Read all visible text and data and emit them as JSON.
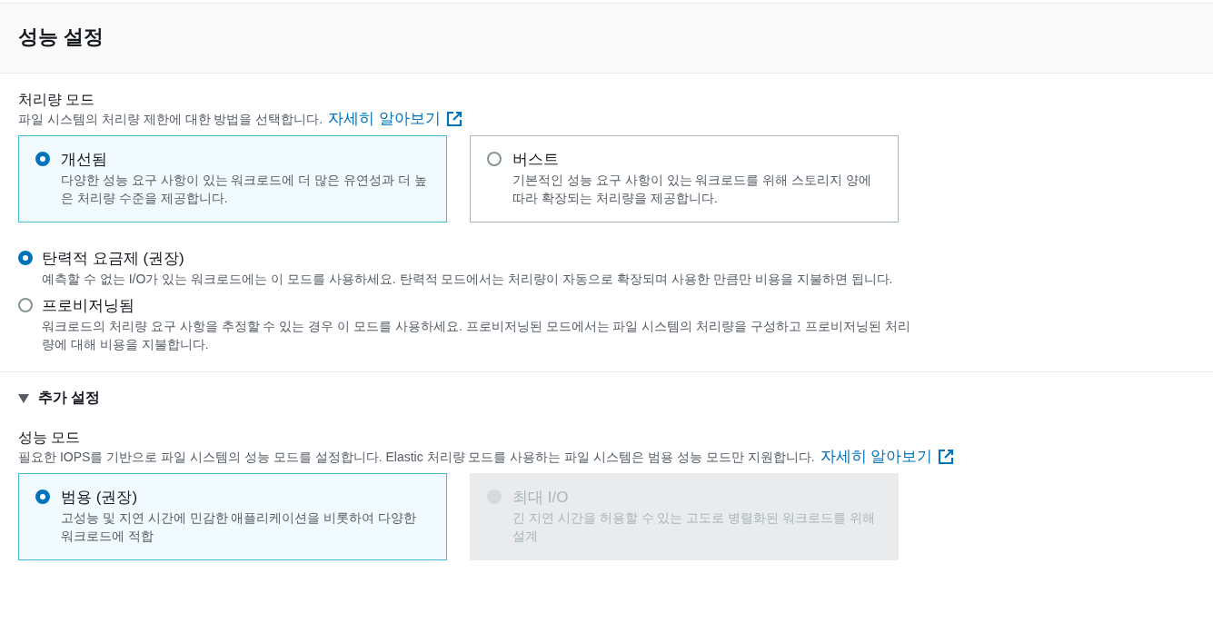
{
  "header": {
    "title": "성능 설정"
  },
  "throughput": {
    "label": "처리량 모드",
    "description": "파일 시스템의 처리량 제한에 대한 방법을 선택합니다.",
    "link": "자세히 알아보기",
    "tiles": [
      {
        "label": "개선됨",
        "description": "다양한 성능 요구 사항이 있는 워크로드에 더 많은 유연성과 더 높은 처리량 수준을 제공합니다.",
        "selected": true,
        "disabled": false
      },
      {
        "label": "버스트",
        "description": "기본적인 성능 요구 사항이 있는 워크로드를 위해 스토리지 양에 따라 확장되는 처리량을 제공합니다.",
        "selected": false,
        "disabled": false
      }
    ]
  },
  "billing_options": [
    {
      "label": "탄력적 요금제 (권장)",
      "description": "예측할 수 없는 I/O가 있는 워크로드에는 이 모드를 사용하세요. 탄력적 모드에서는 처리량이 자동으로 확장되며 사용한 만큼만 비용을 지불하면 됩니다.",
      "selected": true
    },
    {
      "label": "프로비저닝됨",
      "description": "워크로드의 처리량 요구 사항을 추정할 수 있는 경우 이 모드를 사용하세요. 프로비저닝된 모드에서는 파일 시스템의 처리량을 구성하고 프로비저닝된 처리량에 대해 비용을 지불합니다.",
      "selected": false
    }
  ],
  "additional": {
    "title": "추가 설정",
    "expanded": true,
    "performance": {
      "label": "성능 모드",
      "description": "필요한 IOPS를 기반으로 파일 시스템의 성능 모드를 설정합니다. Elastic 처리량 모드를 사용하는 파일 시스템은 범용 성능 모드만 지원합니다.",
      "link": "자세히 알아보기",
      "tiles": [
        {
          "label": "범용 (권장)",
          "description": "고성능 및 지연 시간에 민감한 애플리케이션을 비롯하여 다양한 워크로드에 적합",
          "selected": true,
          "disabled": false
        },
        {
          "label": "최대 I/O",
          "description": "긴 지연 시간을 허용할 수 있는 고도로 병렬화된 워크로드를 위해 설계",
          "selected": false,
          "disabled": true
        }
      ]
    }
  }
}
